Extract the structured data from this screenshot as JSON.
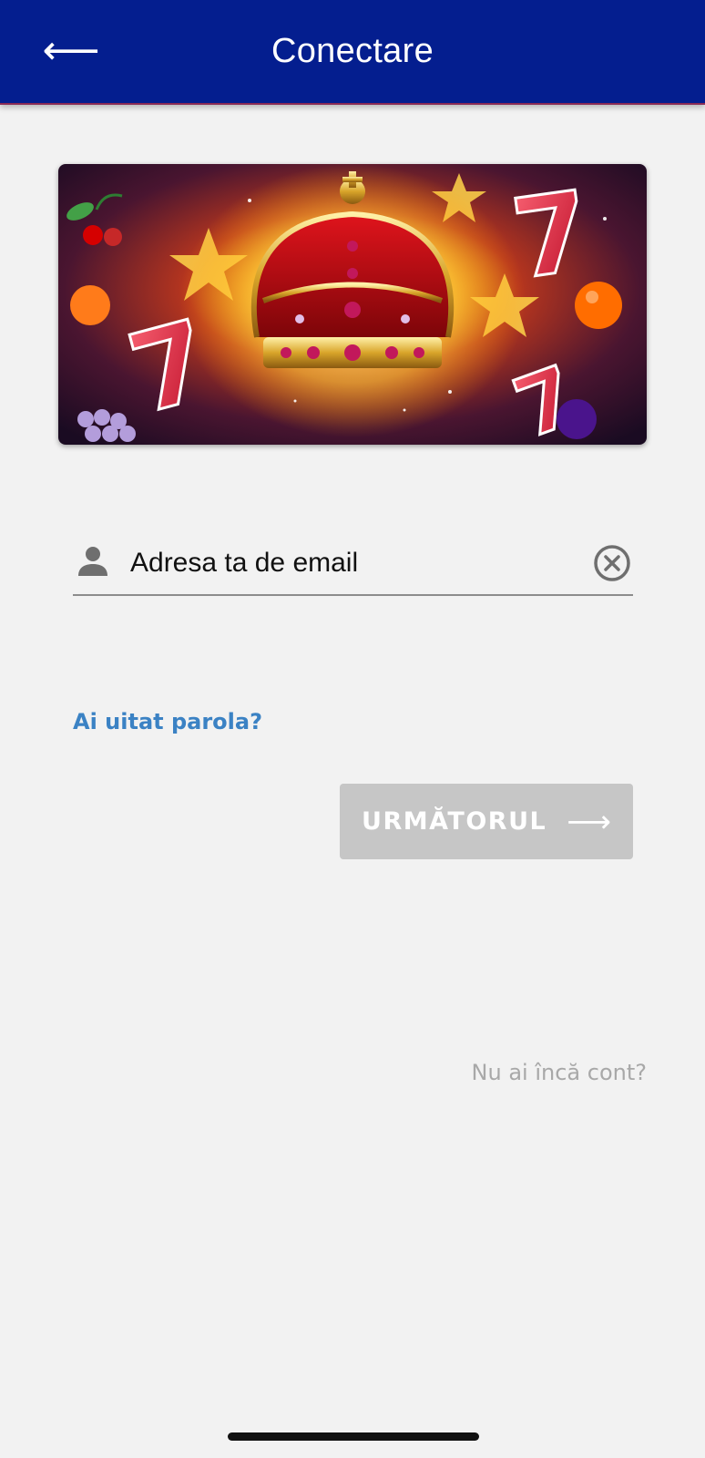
{
  "header": {
    "back_icon": "back-arrow-icon",
    "back_glyph": "⟵",
    "title": "Conectare",
    "background_color": "#041e8f"
  },
  "banner": {
    "description_icons": [
      "crown-icon",
      "seven-icon",
      "cherry-icon",
      "orange-icon",
      "grape-icon",
      "star-icon"
    ]
  },
  "login_form": {
    "email": {
      "icon": "user-icon",
      "placeholder": "Adresa ta de email",
      "value": "",
      "clear_icon": "clear-circle-icon"
    },
    "forgot_password_label": "Ai uitat parola?",
    "next_button": {
      "label": "URMĂTORUL",
      "arrow_glyph": "⟶",
      "background_color": "#c6c6c6",
      "enabled": false
    },
    "signup_prompt": "Nu ai încă cont?"
  },
  "colors": {
    "accent_link": "#3b82c4",
    "page_background": "#f2f2f2"
  }
}
